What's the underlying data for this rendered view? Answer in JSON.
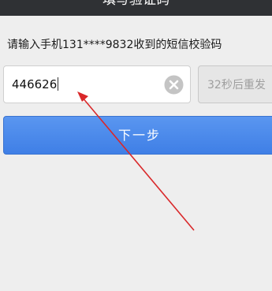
{
  "header": {
    "title": "填写验证码"
  },
  "prompt": {
    "text": "请输入手机131****9832收到的短信校验码"
  },
  "code_input": {
    "value": "446626",
    "clear_icon": "clear-circle-icon"
  },
  "resend": {
    "label": "32秒后重发"
  },
  "next_button": {
    "label": "下一步"
  },
  "colors": {
    "titlebar": "#2f3134",
    "background": "#eeeeee",
    "primary_button": "#4a88ec",
    "annotation_arrow": "#d9282a"
  }
}
